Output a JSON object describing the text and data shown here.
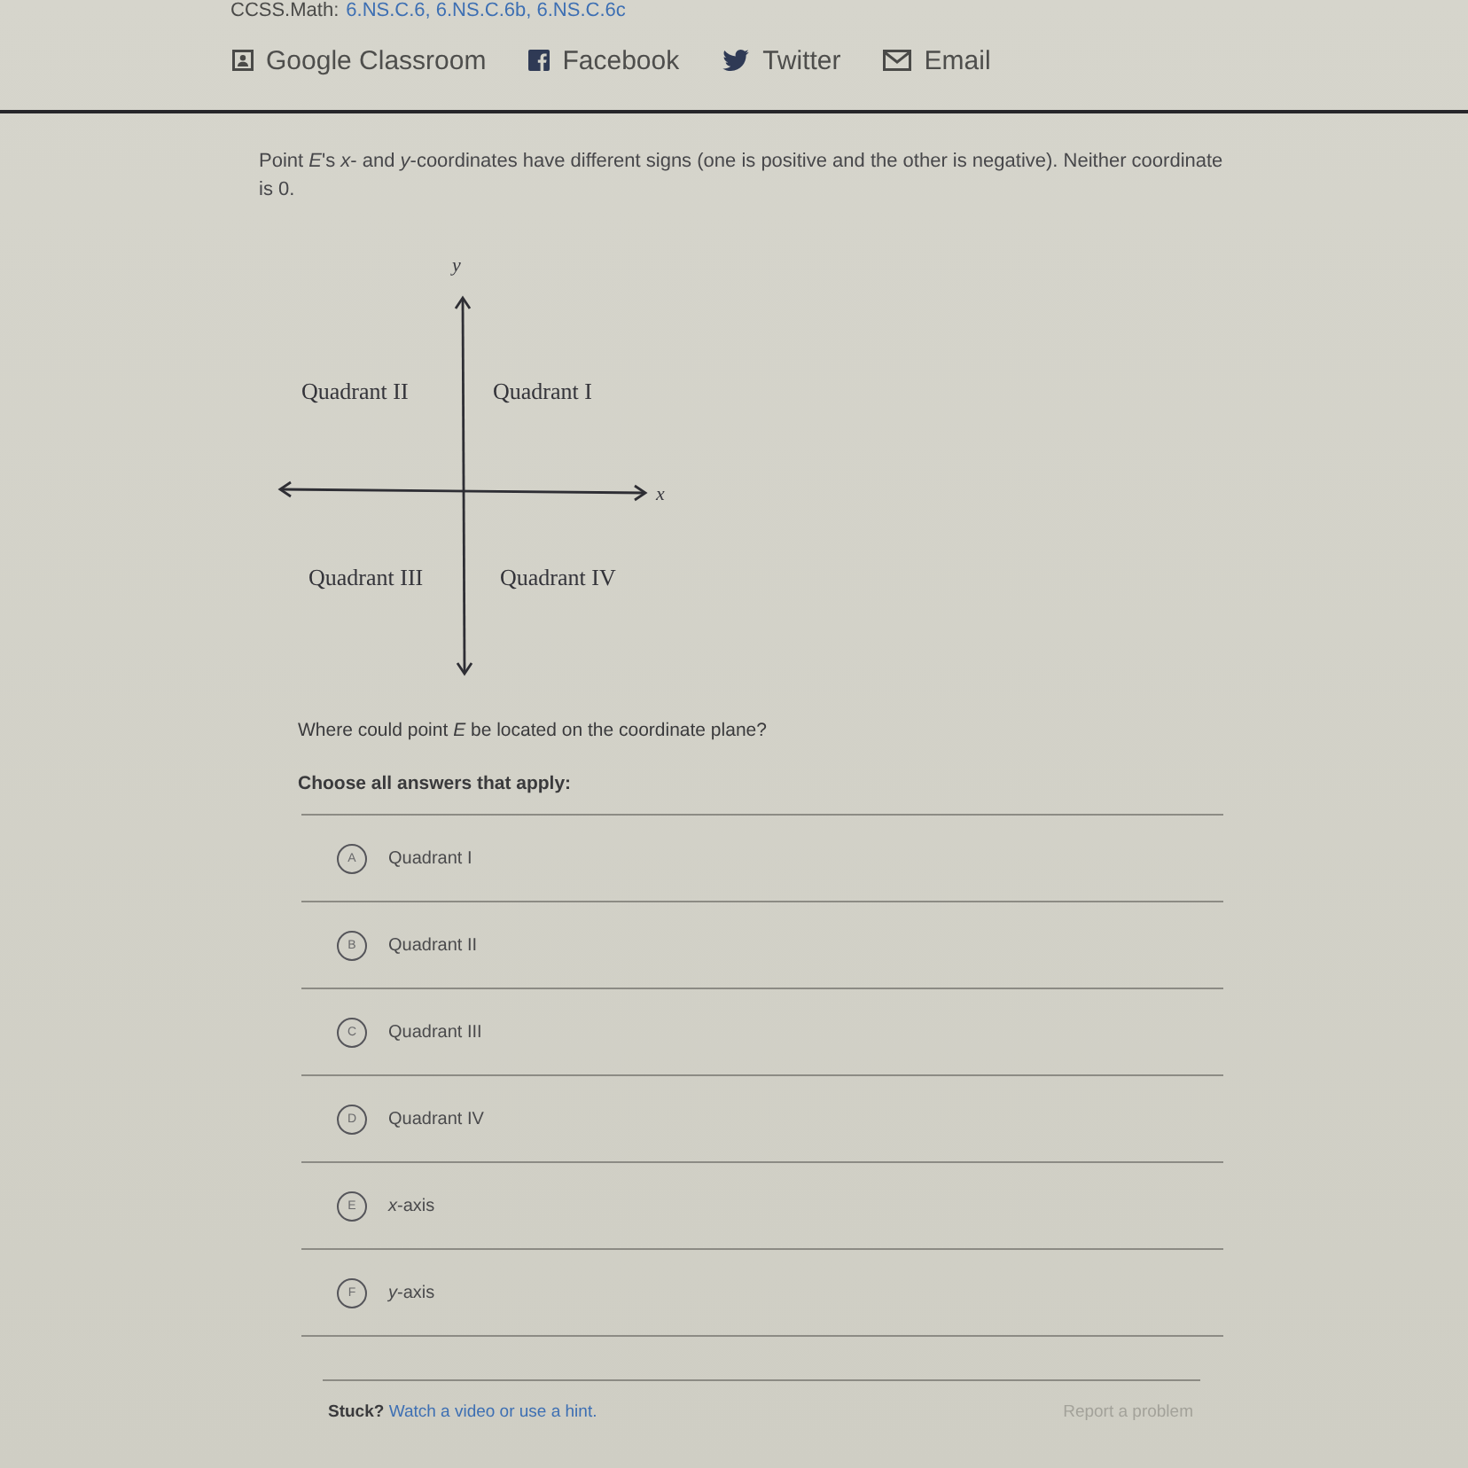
{
  "standards": {
    "label": "CCSS.Math:",
    "codes": "6.NS.C.6, 6.NS.C.6b, 6.NS.C.6c"
  },
  "share": [
    {
      "kind": "classroom",
      "label": "Google Classroom"
    },
    {
      "kind": "facebook",
      "label": "Facebook"
    },
    {
      "kind": "twitter",
      "label": "Twitter"
    },
    {
      "kind": "email",
      "label": "Email"
    }
  ],
  "question": "Point *E*'s *x*- and *y*-coordinates have different signs (one is positive and the other is negative). Neither coordinate is 0.",
  "figure": {
    "y_label": "y",
    "x_label": "x",
    "quadrants": [
      {
        "label": "Quadrant II"
      },
      {
        "label": "Quadrant I"
      },
      {
        "label": "Quadrant III"
      },
      {
        "label": "Quadrant IV"
      }
    ]
  },
  "prompt": "Where could point *E* be located on the coordinate plane?",
  "instruction": "Choose all answers that apply:",
  "choices": [
    {
      "letter": "A",
      "label": "Quadrant I",
      "selected": false
    },
    {
      "letter": "B",
      "label": "Quadrant II",
      "selected": false
    },
    {
      "letter": "C",
      "label": "Quadrant III",
      "selected": false
    },
    {
      "letter": "D",
      "label": "Quadrant IV",
      "selected": false
    },
    {
      "letter": "E",
      "label": "*x*-axis",
      "selected": false
    },
    {
      "letter": "F",
      "label": "*y*-axis",
      "selected": false
    }
  ],
  "help": {
    "prompt": "Stuck?",
    "link": "Watch a video or use a hint."
  },
  "report": "Report a problem"
}
